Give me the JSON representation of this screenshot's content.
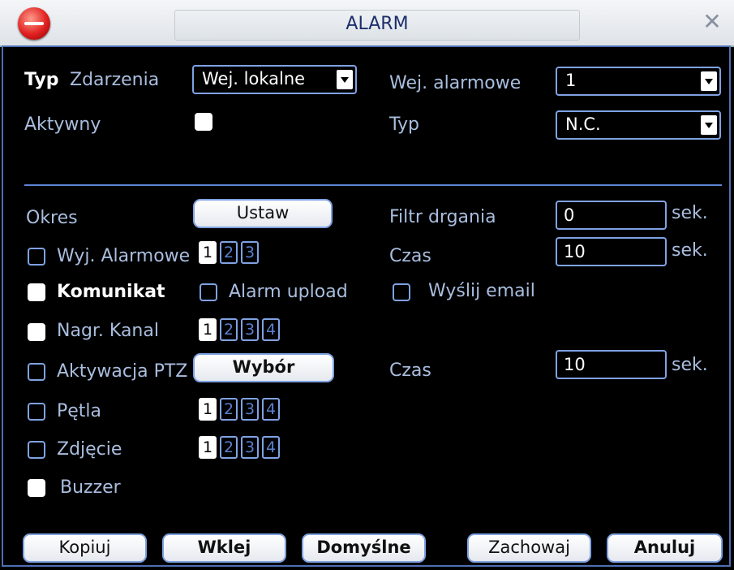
{
  "window": {
    "title": "ALARM",
    "close_icon": "close-icon",
    "rec_icon": "record-icon"
  },
  "top": {
    "typ_prefix": "Typ",
    "typ_label": "Zdarzenia",
    "typ_value": "Wej. lokalne",
    "aktywny_label": "Aktywny",
    "aktywny_checked": true,
    "wej_label": "Wej. alarmowe",
    "wej_value": "1",
    "typ2_label": "Typ",
    "typ2_value": "N.C."
  },
  "body": {
    "okres_label": "Okres",
    "ustaw_button": "Ustaw",
    "filtr_label": "Filtr drgania",
    "filtr_value": "0",
    "filtr_unit": "sek.",
    "wyj_label": "Wyj. Alarmowe",
    "wyj_checked": false,
    "wyj_numbers": [
      "1",
      "2",
      "3"
    ],
    "czas1_label": "Czas",
    "czas1_value": "10",
    "czas1_unit": "sek.",
    "komunikat_label": "Komunikat",
    "komunikat_checked": true,
    "alarm_upload_label": "Alarm upload",
    "alarm_upload_checked": false,
    "email_label": "Wyślij email",
    "email_checked": false,
    "nagr_label": "Nagr. Kanal",
    "nagr_checked": true,
    "nagr_numbers": [
      "1",
      "2",
      "3",
      "4"
    ],
    "ptz_label": "Aktywacja PTZ",
    "ptz_checked": false,
    "wybor_button": "Wybór",
    "czas2_label": "Czas",
    "czas2_value": "10",
    "czas2_unit": "sek.",
    "petla_label": "Pętla",
    "petla_checked": false,
    "petla_numbers": [
      "1",
      "2",
      "3",
      "4"
    ],
    "zdjecie_label": "Zdjęcie",
    "zdjecie_checked": false,
    "zdjecie_numbers": [
      "1",
      "2",
      "3",
      "4"
    ],
    "buzzer_label": "Buzzer",
    "buzzer_checked": true
  },
  "footer": {
    "kopiuj": "Kopiuj",
    "wklej": "Wklej",
    "domyslne": "Domyślne",
    "zachowaj": "Zachowaj",
    "anuluj": "Anuluj"
  },
  "colors": {
    "accent": "#7fa2e2",
    "label": "#a9bdde",
    "title": "#1c2f6b"
  }
}
